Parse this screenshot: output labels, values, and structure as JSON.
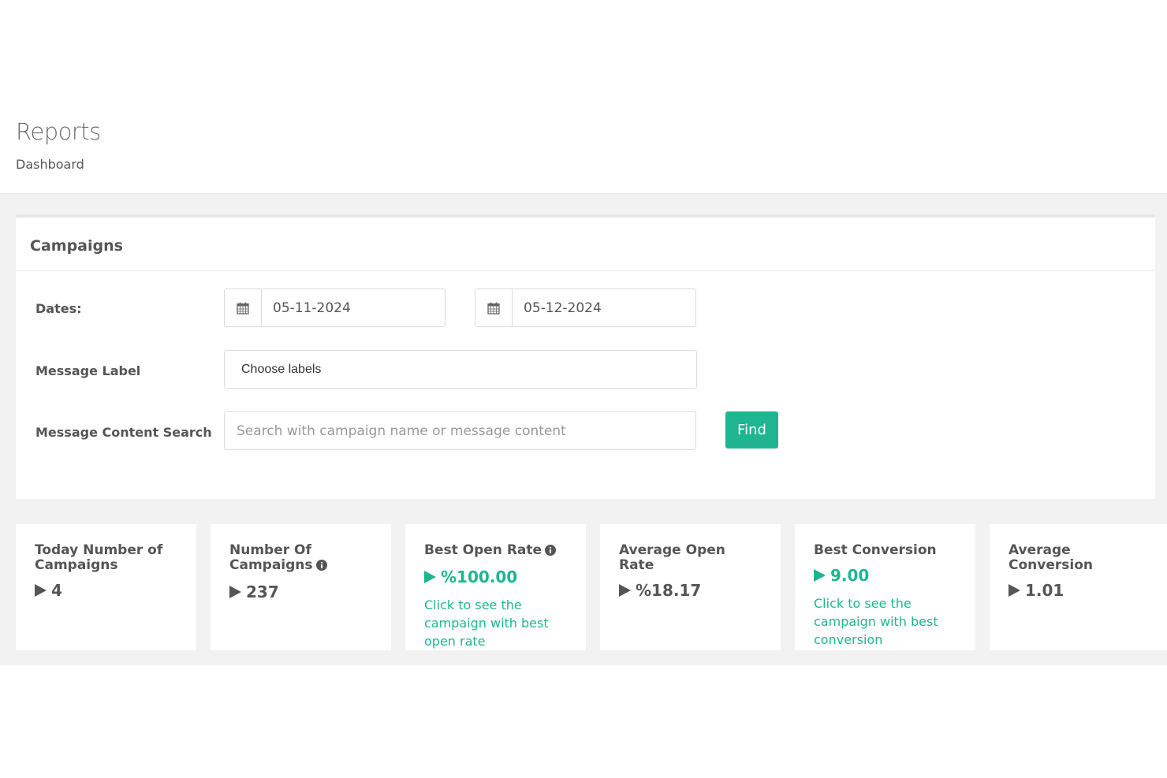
{
  "header": {
    "title": "Reports",
    "subtitle": "Dashboard"
  },
  "campaigns_panel": {
    "title": "Campaigns",
    "dates_label": "Dates:",
    "start_date": "05-11-2024",
    "end_date": "05-12-2024",
    "message_label_label": "Message Label",
    "labels_select_value": "Choose labels",
    "content_search_label": "Message Content Search",
    "search_placeholder": "Search with campaign name or message content",
    "find_button": "Find"
  },
  "stats": [
    {
      "title": "Today Number of Campaigns",
      "value": "4",
      "has_info_icon": false,
      "highlight": false,
      "link": ""
    },
    {
      "title": "Number Of Campaigns",
      "value": "237",
      "has_info_icon": true,
      "highlight": false,
      "link": ""
    },
    {
      "title": "Best Open Rate",
      "value": "%100.00",
      "has_info_icon": true,
      "highlight": true,
      "link": "Click to see the campaign with best open rate"
    },
    {
      "title": "Average Open Rate",
      "value": "%18.17",
      "has_info_icon": false,
      "highlight": false,
      "link": ""
    },
    {
      "title": "Best Conversion",
      "value": "9.00",
      "has_info_icon": false,
      "highlight": true,
      "link": "Click to see the campaign with best conversion"
    },
    {
      "title": "Average Conversion",
      "value": "1.01",
      "has_info_icon": false,
      "highlight": false,
      "link": ""
    }
  ],
  "colors": {
    "accent": "#1fb591",
    "text": "#555555",
    "background": "#f2f2f2"
  },
  "icons": {
    "date_addon": "calendar-icon",
    "info": "info-circle-icon",
    "value_marker": "caret-right-icon"
  }
}
